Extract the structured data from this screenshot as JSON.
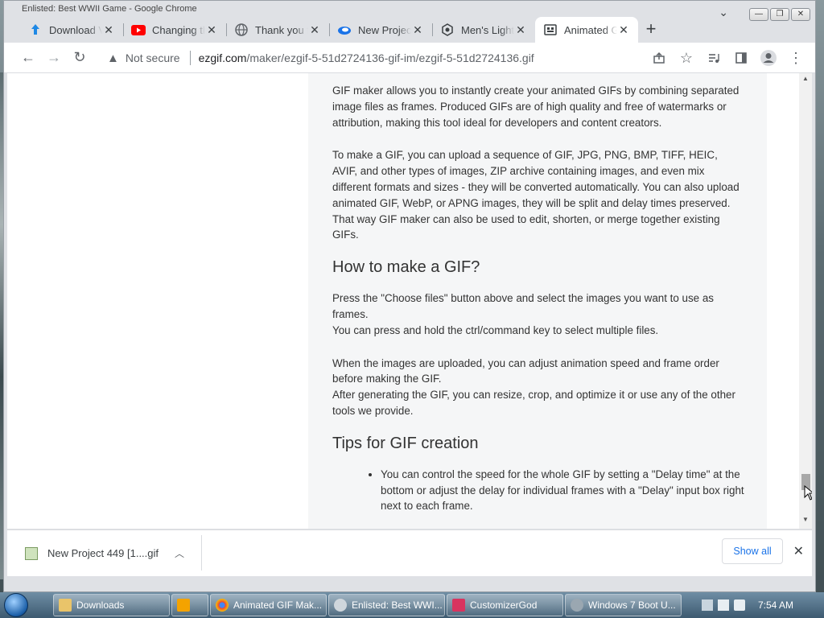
{
  "os_window": {
    "title": "Enlisted: Best WWII Game - Google Chrome",
    "controls": [
      "—",
      "❐",
      "✕"
    ]
  },
  "tabs": [
    {
      "title": "Download V",
      "icon": "download-icon"
    },
    {
      "title": "Changing th",
      "icon": "youtube-icon"
    },
    {
      "title": "Thank you f",
      "icon": "globe-icon"
    },
    {
      "title": "New Project",
      "icon": "cloud-icon"
    },
    {
      "title": "Men's Light",
      "icon": "hexagon-icon"
    },
    {
      "title": "Animated G",
      "icon": "ezgif-icon",
      "active": true
    }
  ],
  "toolbar": {
    "back": "←",
    "forward": "→",
    "reload": "↻",
    "security_label": "Not secure",
    "url_host": "ezgif.com",
    "url_path": "/maker/ezgif-5-51d2724136-gif-im/ezgif-5-51d2724136.gif"
  },
  "article": {
    "p1": "GIF maker allows you to instantly create your animated GIFs by combining separated image files as frames. Produced GIFs are of high quality and free of watermarks or attribution, making this tool ideal for developers and content creators.",
    "p2": "To make a GIF, you can upload a sequence of GIF, JPG, PNG, BMP, TIFF, HEIC, AVIF, and other types of images, ZIP archive containing images, and even mix different formats and sizes - they will be converted automatically. You can also upload animated GIF, WebP, or APNG images, they will be split and delay times preserved. That way GIF maker can also be used to edit, shorten, or merge together existing GIFs.",
    "h_how": "How to make a GIF?",
    "p3a": "Press the \"Choose files\" button above and select the images you want to use as frames.",
    "p3b": "You can press and hold the ctrl/command key to select multiple files.",
    "p4a": "When the images are uploaded, you can adjust animation speed and frame order before making the GIF.",
    "p4b": "After generating the GIF, you can resize, crop, and optimize it or use any of the other tools we provide.",
    "h_tips": "Tips for GIF creation",
    "tip1": "You can control the speed for the whole GIF by setting a \"Delay time\" at the bottom or adjust the delay for individual frames with a \"Delay\" input box right next to each frame."
  },
  "download_bar": {
    "file_name": "New Project 449 [1....gif",
    "show_all": "Show all"
  },
  "taskbar": {
    "items": [
      {
        "label": "Downloads",
        "icon": "folder-icon"
      },
      {
        "label": "",
        "icon": "media-player-icon"
      },
      {
        "label": "Animated GIF Mak...",
        "icon": "chrome-icon"
      },
      {
        "label": "Enlisted: Best WWI...",
        "icon": "globe-icon"
      },
      {
        "label": "CustomizerGod",
        "icon": "customizer-icon"
      },
      {
        "label": "Windows 7 Boot U...",
        "icon": "disk-icon"
      }
    ],
    "clock": "7:54 AM"
  }
}
